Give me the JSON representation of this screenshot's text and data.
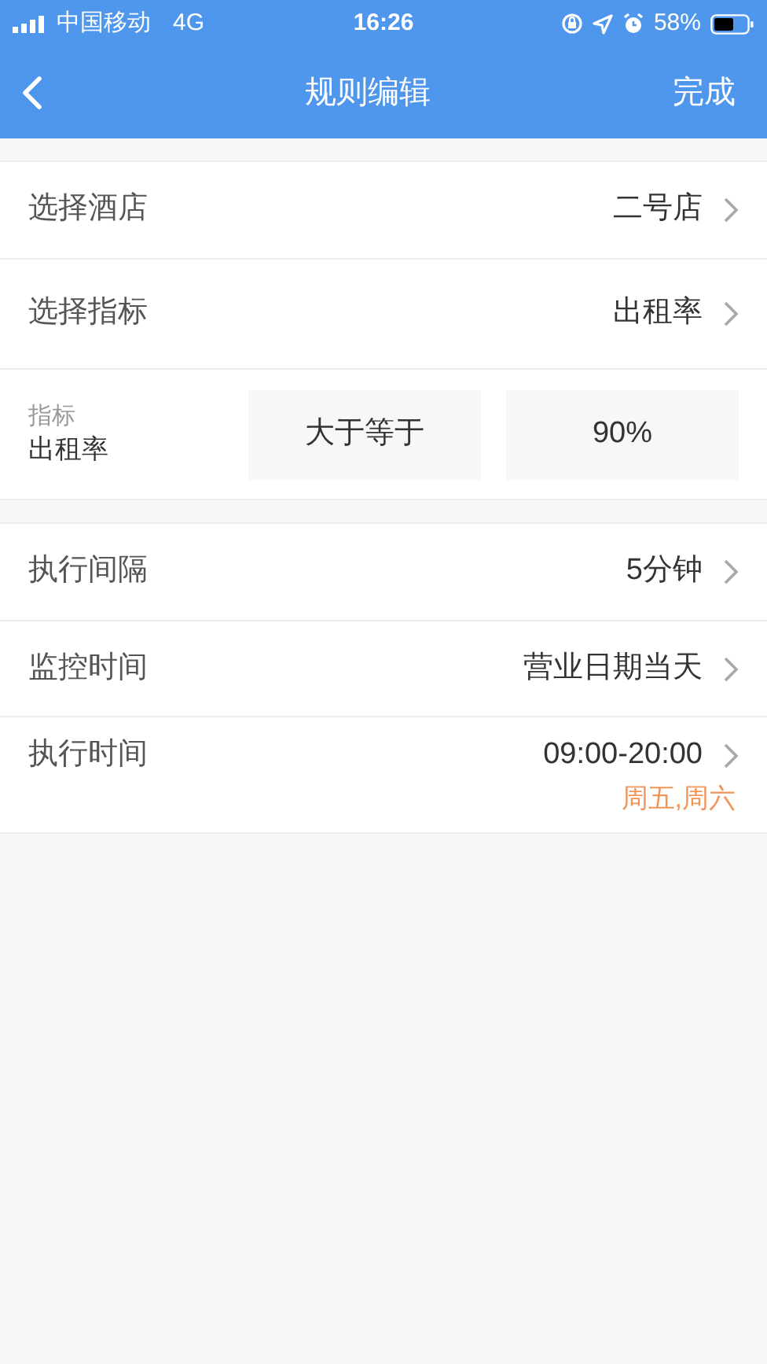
{
  "status_bar": {
    "carrier": "中国移动",
    "network": "4G",
    "time": "16:26",
    "battery": "58%"
  },
  "nav": {
    "title": "规则编辑",
    "action": "完成"
  },
  "sections": [
    {
      "rows": [
        {
          "kind": "select",
          "label": "选择酒店",
          "value": "二号店"
        },
        {
          "kind": "select",
          "label": "选择指标",
          "value": "出租率"
        },
        {
          "kind": "condition",
          "caption": "指标",
          "label": "出租率",
          "operator": "大于等于",
          "threshold": "90%"
        }
      ]
    },
    {
      "rows": [
        {
          "kind": "select",
          "label": "执行间隔",
          "value": "5分钟"
        },
        {
          "kind": "select",
          "label": "监控时间",
          "value": "营业日期当天"
        },
        {
          "kind": "select",
          "label": "执行时间",
          "value": "09:00-20:00",
          "note": "周五,周六"
        }
      ]
    }
  ]
}
